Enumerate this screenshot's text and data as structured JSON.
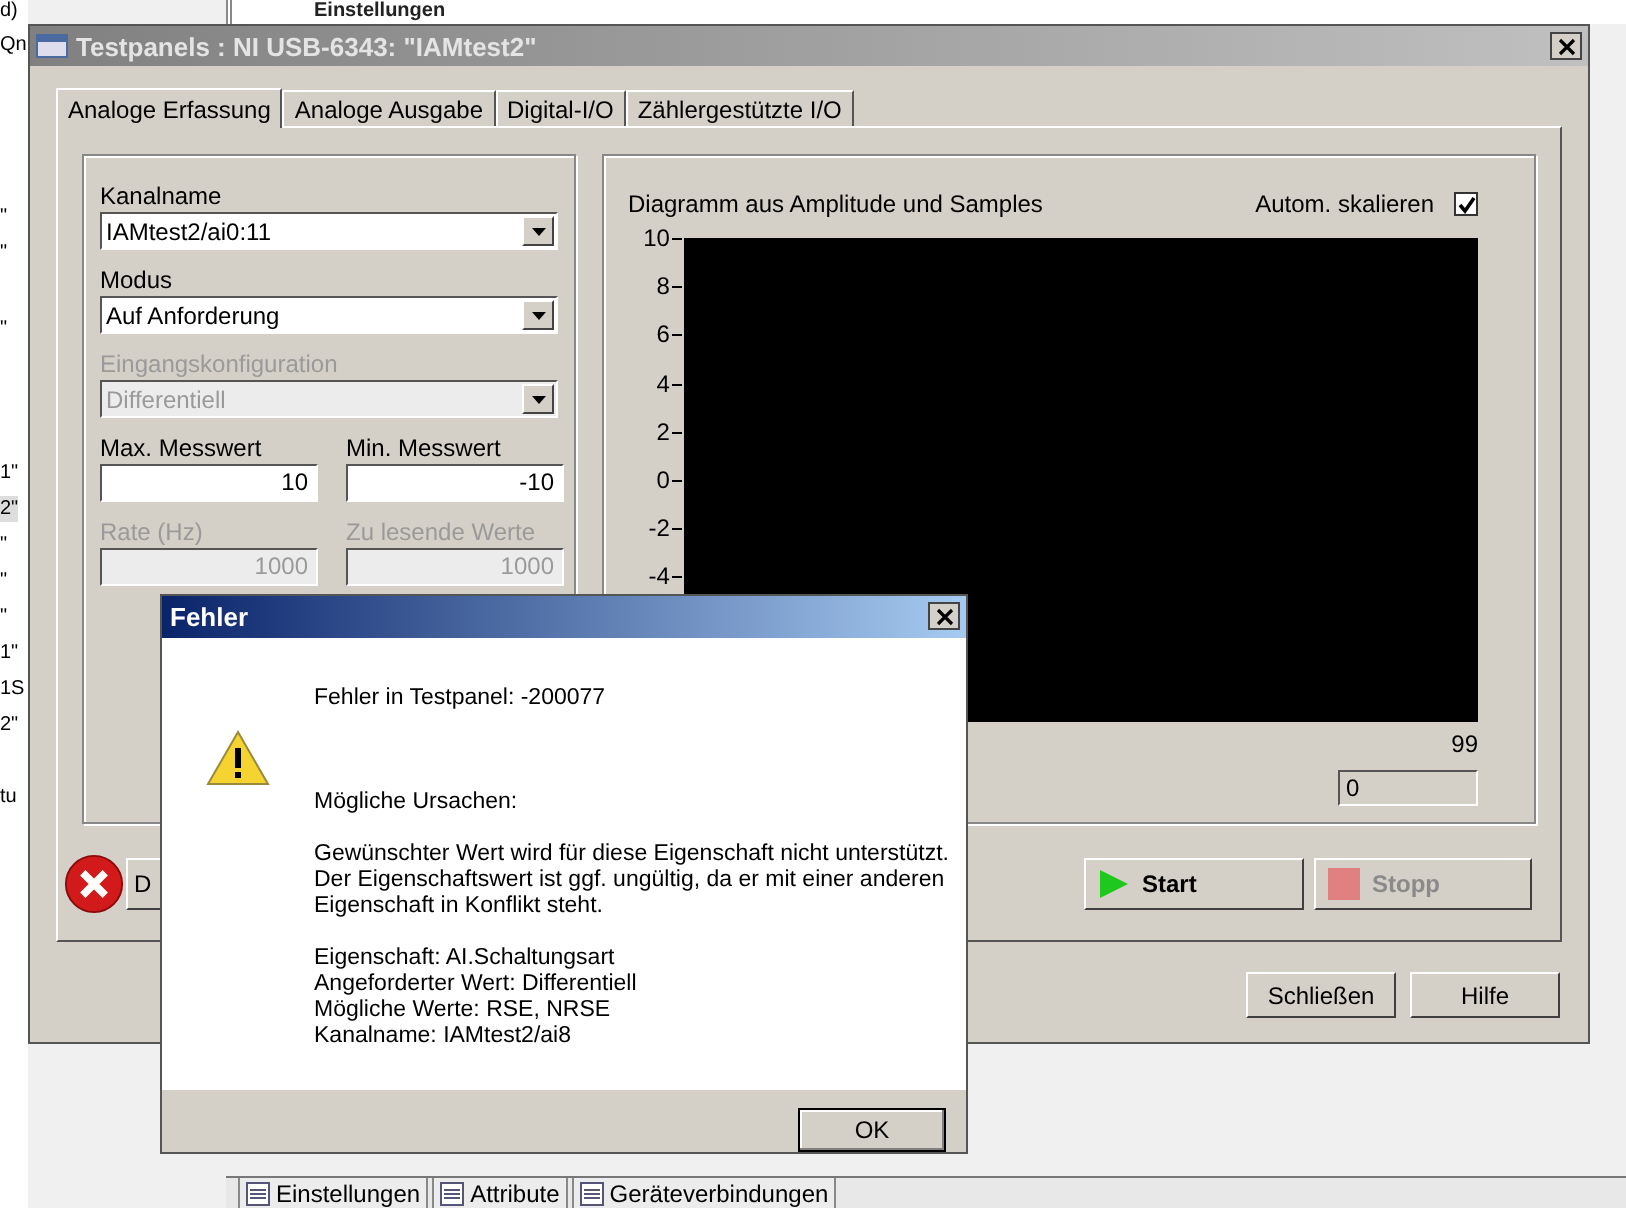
{
  "background_app": {
    "header": "Einstellungen",
    "side_list": [
      {
        "text": "d)",
        "selected": false
      },
      {
        "text": "Qn",
        "selected": false
      },
      {
        "text": "\"",
        "selected": false
      },
      {
        "text": "\"",
        "selected": false
      },
      {
        "text": "\"",
        "selected": false
      },
      {
        "text": "1\"",
        "selected": false
      },
      {
        "text": "2\"",
        "selected": true
      },
      {
        "text": "\"",
        "selected": false
      },
      {
        "text": "\"",
        "selected": false
      },
      {
        "text": "\"",
        "selected": false
      },
      {
        "text": "1\"",
        "selected": false
      },
      {
        "text": "1S",
        "selected": false
      },
      {
        "text": "2\"",
        "selected": false
      },
      {
        "text": "tu",
        "selected": false
      }
    ],
    "bottom_tabs": [
      {
        "label": "Einstellungen",
        "selected": false
      },
      {
        "label": "Attribute",
        "selected": false
      },
      {
        "label": "Geräteverbindungen",
        "selected": false
      }
    ]
  },
  "window": {
    "title": "Testpanels : NI USB-6343: \"IAMtest2\"",
    "tabs": [
      {
        "label": "Analoge Erfassung",
        "selected": true
      },
      {
        "label": "Analoge Ausgabe",
        "selected": false
      },
      {
        "label": "Digital-I/O",
        "selected": false
      },
      {
        "label": "Zählergestützte I/O",
        "selected": false
      }
    ],
    "settings": [
      {
        "kind": "combo",
        "label": "Kanalname",
        "value": "IAMtest2/ai0:11",
        "disabled": false
      },
      {
        "kind": "combo",
        "label": "Modus",
        "value": "Auf Anforderung",
        "disabled": false
      },
      {
        "kind": "combo",
        "label": "Eingangskonfiguration",
        "value": "Differentiell",
        "disabled": true
      },
      {
        "kind": "pair",
        "fields": [
          {
            "label": "Max. Messwert",
            "value": "10",
            "disabled": false
          },
          {
            "label": "Min. Messwert",
            "value": "-10",
            "disabled": false
          }
        ]
      },
      {
        "kind": "pair",
        "fields": [
          {
            "label": "Rate (Hz)",
            "value": "1000",
            "disabled": true
          },
          {
            "label": "Zu lesende Werte",
            "value": "1000",
            "disabled": true
          }
        ]
      }
    ],
    "chart": {
      "title": "Diagramm aus Amplitude und Samples",
      "autoscale_label": "Autom. skalieren",
      "autoscale_checked": true,
      "y_ticks": [
        "10",
        "8",
        "6",
        "4",
        "2",
        "0",
        "-2",
        "-4"
      ],
      "x_tick_end": "99",
      "readout": "0"
    },
    "error_button": "D",
    "start_button": {
      "label": "Start",
      "disabled": false
    },
    "stop_button": {
      "label": "Stopp",
      "disabled": true
    },
    "footer_buttons": [
      "Schließen",
      "Hilfe"
    ]
  },
  "dialog": {
    "title": "Fehler",
    "heading": "Fehler in Testpanel: -200077",
    "causes_title": "Mögliche Ursachen:",
    "cause_lines": [
      "Gewünschter Wert wird für diese Eigenschaft nicht unterstützt.",
      "Der Eigenschaftswert ist ggf. ungültig, da er mit einer anderen",
      "Eigenschaft in Konflikt steht."
    ],
    "details": [
      "Eigenschaft: AI.Schaltungsart",
      "Angeforderter Wert: Differentiell",
      "Mögliche Werte: RSE, NRSE",
      "Kanalname: IAMtest2/ai8"
    ],
    "ok_button": "OK"
  }
}
